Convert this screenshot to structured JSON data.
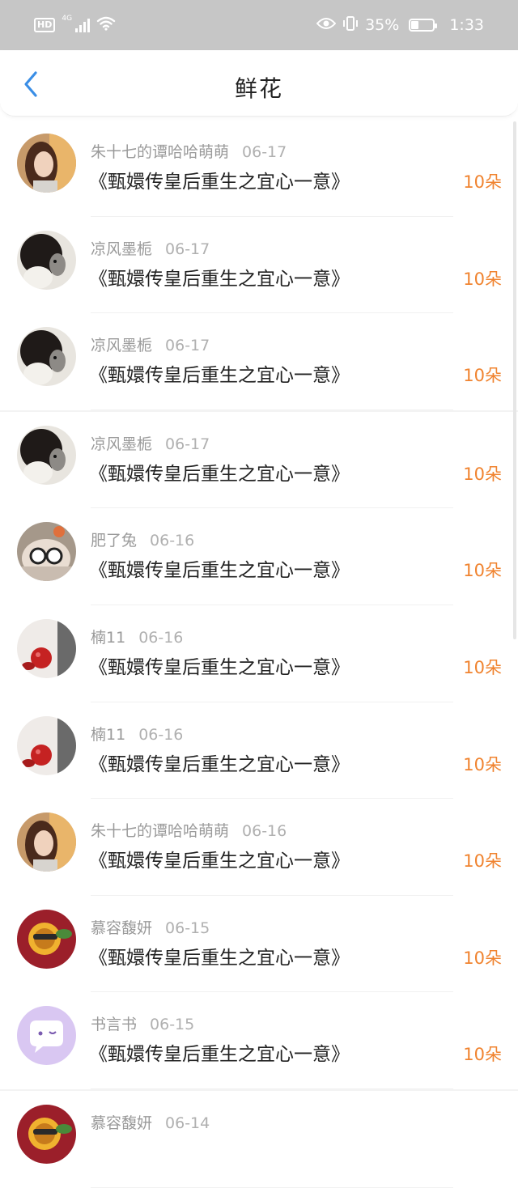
{
  "status_bar": {
    "hd_badge": "HD",
    "network": "4G",
    "battery_percent": "35%",
    "battery_level": 0.35,
    "time": "1:33",
    "icons": [
      "hd-icon",
      "signal-icon",
      "wifi-icon",
      "eye-icon",
      "vibrate-icon",
      "battery-icon"
    ]
  },
  "header": {
    "title": "鲜花",
    "back_icon": "chevron-left-icon",
    "accent": "#3a8ee6"
  },
  "colors": {
    "count": "#f0832f"
  },
  "items": [
    {
      "user": "朱十七的谭哈哈萌萌",
      "date": "06-17",
      "book": "《甄嬛传皇后重生之宜心一意》",
      "count": "10朵",
      "avatar": "portrait-girl"
    },
    {
      "user": "凉风墨栀",
      "date": "06-17",
      "book": "《甄嬛传皇后重生之宜心一意》",
      "count": "10朵",
      "avatar": "dark-hair-dog"
    },
    {
      "user": "凉风墨栀",
      "date": "06-17",
      "book": "《甄嬛传皇后重生之宜心一意》",
      "count": "10朵",
      "avatar": "dark-hair-dog"
    },
    {
      "user": "凉风墨栀",
      "date": "06-17",
      "book": "《甄嬛传皇后重生之宜心一意》",
      "count": "10朵",
      "avatar": "dark-hair-dog"
    },
    {
      "user": "肥了兔",
      "date": "06-16",
      "book": "《甄嬛传皇后重生之宜心一意》",
      "count": "10朵",
      "avatar": "rabbit-goggles"
    },
    {
      "user": "楠11",
      "date": "06-16",
      "book": "《甄嬛传皇后重生之宜心一意》",
      "count": "10朵",
      "avatar": "red-apple"
    },
    {
      "user": "楠11",
      "date": "06-16",
      "book": "《甄嬛传皇后重生之宜心一意》",
      "count": "10朵",
      "avatar": "red-apple"
    },
    {
      "user": "朱十七的谭哈哈萌萌",
      "date": "06-16",
      "book": "《甄嬛传皇后重生之宜心一意》",
      "count": "10朵",
      "avatar": "portrait-girl"
    },
    {
      "user": "慕容馥妍",
      "date": "06-15",
      "book": "《甄嬛传皇后重生之宜心一意》",
      "count": "10朵",
      "avatar": "sunflower-red"
    },
    {
      "user": "书言书",
      "date": "06-15",
      "book": "《甄嬛传皇后重生之宜心一意》",
      "count": "10朵",
      "avatar": "purple-chat"
    },
    {
      "user": "慕容馥妍",
      "date": "06-14",
      "book": "",
      "count": "",
      "avatar": "sunflower-red"
    }
  ]
}
